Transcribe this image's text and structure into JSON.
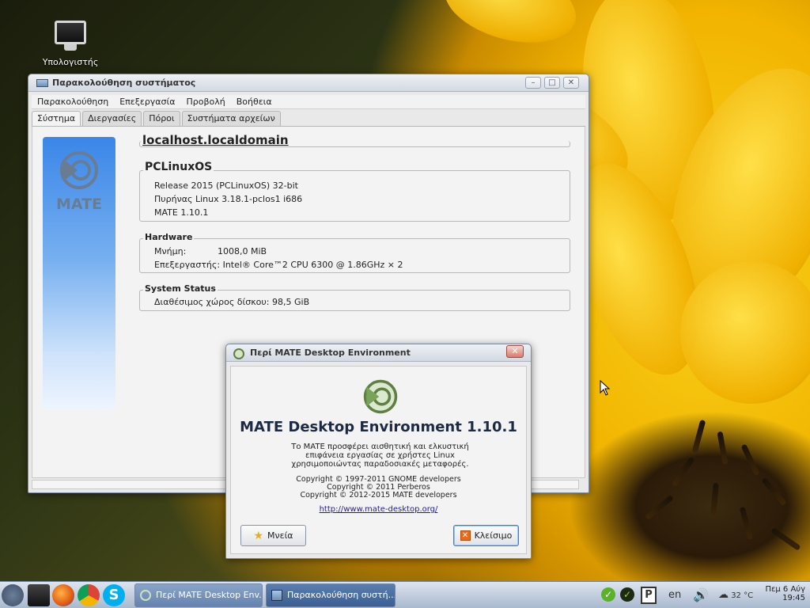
{
  "desktop": {
    "icon_label": "Υπολογιστής"
  },
  "sysmon": {
    "title": "Παρακολούθηση συστήματος",
    "menu": [
      "Παρακολούθηση",
      "Επεξεργασία",
      "Προβολή",
      "Βοήθεια"
    ],
    "tabs": [
      "Σύστημα",
      "Διεργασίες",
      "Πόροι",
      "Συστήματα αρχείων"
    ],
    "active_tab": "Σύστημα",
    "logo_text": "MATE",
    "hostname": "localhost.localdomain",
    "os": {
      "name": "PCLinuxOS",
      "release": "Release 2015 (PCLinuxOS) 32-bit",
      "kernel": "Πυρήνας Linux 3.18.1-pclos1 i686",
      "mate": "MATE 1.10.1"
    },
    "hardware": {
      "header": "Hardware",
      "memory_label": "Μνήμη:",
      "memory_value": "1008,0 MiB",
      "cpu_label": "Επεξεργαστής:",
      "cpu_value": "Intel® Core™2 CPU 6300 @ 1.86GHz × 2"
    },
    "status": {
      "header": "System Status",
      "disk_label": "Διαθέσιμος χώρος δίσκου:",
      "disk_value": "98,5 GiB"
    }
  },
  "about": {
    "title": "Περί MATE Desktop Environment",
    "name": "MATE Desktop Environment 1.10.1",
    "desc_lines": [
      "Το MATE προσφέρει αισθητική και ελκυστική",
      "επιφάνεια εργασίας σε χρήστες Linux",
      "χρησιμοποιώντας παραδοσιακές μεταφορές."
    ],
    "copyright": [
      "Copyright © 1997-2011 GNOME developers",
      "Copyright © 2011 Perberos",
      "Copyright © 2012-2015 MATE developers"
    ],
    "link": "http://www.mate-desktop.org/",
    "credits_label": "Μνεία",
    "close_label": "Κλείσιμο"
  },
  "taskbar": {
    "tasks": [
      "Περί MATE Desktop Env...",
      "Παρακολούθηση συστή..."
    ],
    "keyboard_layout": "en",
    "temperature": "32 °C",
    "clock_date": "Πεμ  6 Αύγ",
    "clock_time": "19:45"
  },
  "icons": [
    "computer-icon",
    "mate-logo-icon",
    "firefox-icon",
    "chrome-icon",
    "skype-icon",
    "terminal-icon",
    "volume-icon",
    "weather-icon"
  ],
  "colors": {
    "accent": "#3b5f94",
    "mate_green": "#5f7f43",
    "link": "#1a1ab0"
  }
}
